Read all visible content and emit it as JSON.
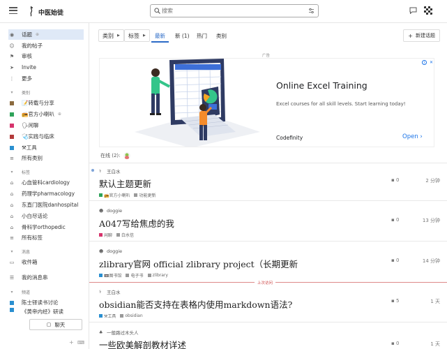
{
  "header": {
    "site_title": "中医始徒",
    "search_placeholder": "搜索"
  },
  "sidebar": {
    "items": [
      {
        "label": "话题",
        "extra": "⊕"
      },
      {
        "label": "我的帖子"
      },
      {
        "label": "审核"
      },
      {
        "label": "Invite"
      },
      {
        "label": "更多"
      }
    ],
    "categories_title": "类别",
    "categories": [
      {
        "label": "📝转载与分享",
        "color": "#8b6a3e"
      },
      {
        "label": "📻官方小喇叭",
        "color": "#2fa35a",
        "extra": "⊕"
      },
      {
        "label": "🗣闲聊",
        "color": "#d6336c"
      },
      {
        "label": "🩺实践与临床",
        "color": "#b33a3a"
      },
      {
        "label": "⚒工具",
        "color": "#2a8fd0"
      },
      {
        "label": "所有类别"
      }
    ],
    "tags_title": "标签",
    "tags": [
      {
        "label": "心血管科cardiology"
      },
      {
        "label": "药理学pharmacology"
      },
      {
        "label": "东直门医院danhospital"
      },
      {
        "label": "小白尽话论"
      },
      {
        "label": "骨科学orthopedic"
      },
      {
        "label": "所有标签"
      }
    ],
    "messages_title": "消息",
    "messages": [
      {
        "label": "收件箱"
      }
    ],
    "my_messages": "我的消息串",
    "channels_title": "频道",
    "channels": [
      {
        "label": "陈士铎读书讨论"
      },
      {
        "label": "《黄帝内经》研读"
      }
    ],
    "chat_label": "聊天"
  },
  "nav": {
    "category_drop": "类别",
    "tag_drop": "标签",
    "tabs": [
      "最新",
      "新 (1)",
      "热门",
      "类别"
    ],
    "new_topic": "新建话题"
  },
  "ad": {
    "label": "广告",
    "title": "Online Excel Training",
    "description": "Excel courses for all skill levels. Start learning today!",
    "brand": "Codefinity",
    "cta": "Open"
  },
  "online": {
    "label": "在线 (2):"
  },
  "topics": [
    {
      "author": "王白水",
      "title": "默认主题更新",
      "tags": [
        {
          "label": "📻官方小喇叭",
          "color": "#2fa35a"
        },
        {
          "label": "功能更新",
          "color": "#999999"
        }
      ],
      "replies": "0",
      "ago": "2 分钟"
    },
    {
      "author": "doggie",
      "title": "A047写给焦虑的我",
      "tags": [
        {
          "label": "闲聊",
          "color": "#d6336c"
        },
        {
          "label": "白水信",
          "color": "#999999"
        }
      ],
      "replies": "0",
      "ago": "13 分钟"
    },
    {
      "author": "doggie",
      "title": "zlibrary官网 official zlibrary project（长期更新",
      "tags": [
        {
          "label": "📼图书馆",
          "color": "#2a8fd0"
        },
        {
          "label": "电子书",
          "color": "#999999"
        },
        {
          "label": "zlibrary",
          "color": "#999999"
        }
      ],
      "replies": "0",
      "ago": "14 分钟"
    },
    {
      "author": "王白水",
      "title": "obsidian能否支持在表格内使用markdown语法?",
      "tags": [
        {
          "label": "⚒工具",
          "color": "#2a8fd0"
        },
        {
          "label": "obsidian",
          "color": "#999999"
        }
      ],
      "replies": "5",
      "ago": "1 天"
    },
    {
      "author": "一般路过木头人",
      "title": "一些欧美解剖教材详述",
      "tags": [],
      "replies": "0",
      "ago": "1 天"
    }
  ],
  "last_visit_label": "上次访问",
  "colors": {
    "accent": "#2b6bc7",
    "active_bg": "#dfe9f7",
    "last_visit": "#cc4444"
  }
}
